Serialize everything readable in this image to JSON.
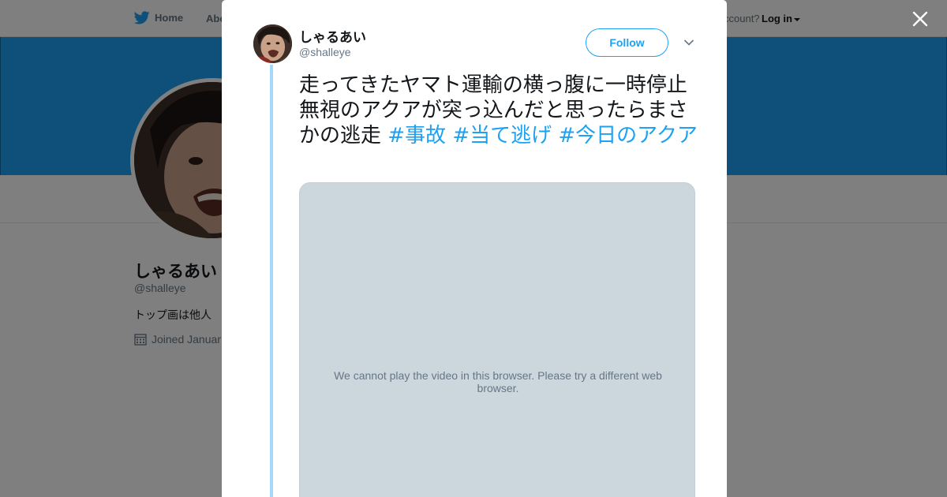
{
  "nav": {
    "home_label": "Home",
    "about_label": "Abo",
    "account_prompt": "ccount?",
    "login_label": "Log in"
  },
  "profile": {
    "name": "しゃるあい",
    "handle": "@shalleye",
    "bio": "トップ画は他人",
    "joined": "Joined Januar"
  },
  "tweet": {
    "author_name": "しゃるあい",
    "author_handle": "@shalleye",
    "follow_label": "Follow",
    "text": "走ってきたヤマト運輸の横っ腹に一時停止無視のアクアが突っ込んだと思ったらまさかの逃走 ",
    "hashtags": [
      "#事故",
      "#当て逃げ",
      "#今日のアクア"
    ],
    "video_message": "We cannot play the video in this browser. Please try a different web browser."
  },
  "colors": {
    "brand": "#1da1f2",
    "thread_line": "#a5d9f9",
    "video_bg": "#ccd6dd",
    "overlay": "rgba(0,0,0,0.5)"
  },
  "icons": [
    "twitter-bird-icon",
    "calendar-icon",
    "close-icon",
    "chevron-down-icon",
    "caret-down-icon"
  ]
}
